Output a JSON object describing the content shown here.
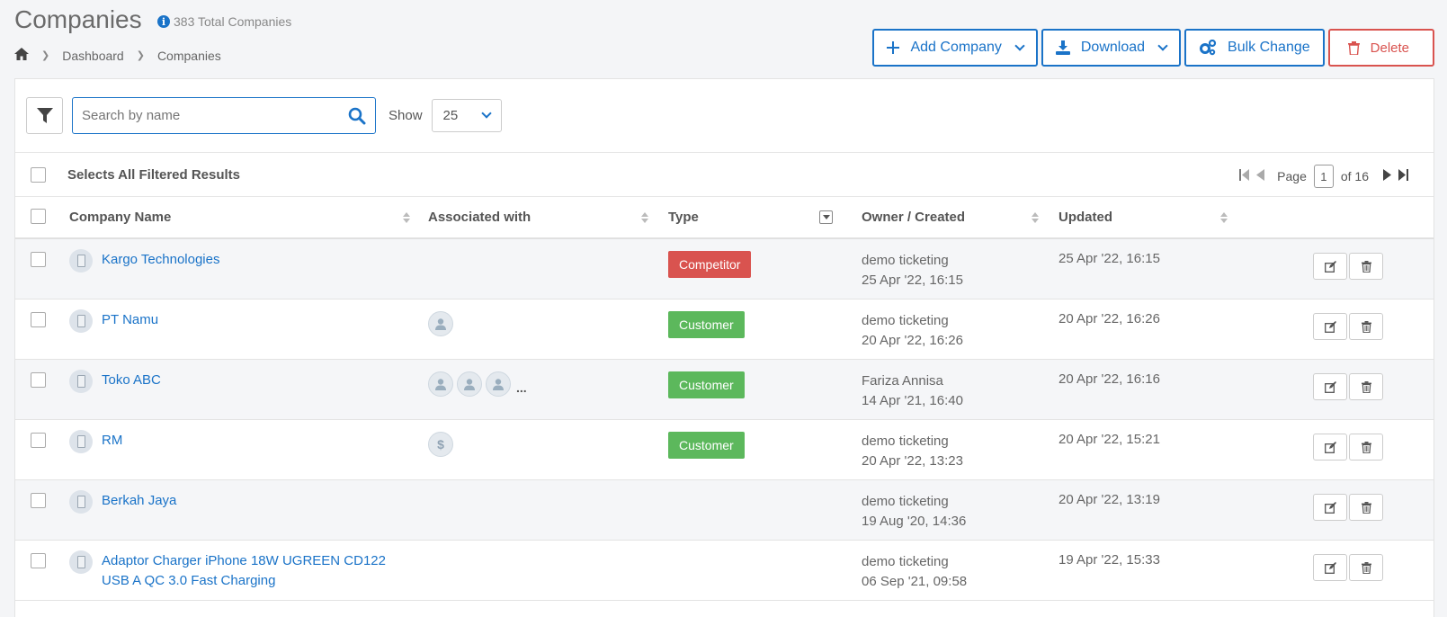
{
  "header": {
    "title": "Companies",
    "total": "383 Total Companies",
    "breadcrumb": [
      "Dashboard",
      "Companies"
    ]
  },
  "actions": {
    "add": "Add Company",
    "download": "Download",
    "bulk": "Bulk Change",
    "delete": "Delete"
  },
  "toolbar": {
    "search_placeholder": "Search by name",
    "show_label": "Show",
    "page_size": "25"
  },
  "selection": {
    "label": "Selects All Filtered Results"
  },
  "pager": {
    "page_label": "Page",
    "current": "1",
    "of_label": "of 16"
  },
  "columns": {
    "name": "Company Name",
    "associated": "Associated with",
    "type": "Type",
    "owner": "Owner / Created",
    "updated": "Updated"
  },
  "colors": {
    "accent": "#1a73c8",
    "competitor": "#d9534f",
    "customer": "#5cb85c",
    "danger": "#d9534f"
  },
  "rows": [
    {
      "name": "Kargo Technologies",
      "assoc": [],
      "more": "",
      "type": "Competitor",
      "owner": "demo ticketing",
      "created": "25 Apr '22, 16:15",
      "updated": "25 Apr '22, 16:15"
    },
    {
      "name": "PT Namu",
      "assoc": [
        "person-icon"
      ],
      "more": "",
      "type": "Customer",
      "owner": "demo ticketing",
      "created": "20 Apr '22, 16:26",
      "updated": "20 Apr '22, 16:26"
    },
    {
      "name": "Toko ABC",
      "assoc": [
        "person-icon",
        "person-icon",
        "person-icon"
      ],
      "more": "...",
      "type": "Customer",
      "owner": "Fariza Annisa",
      "created": "14 Apr '21, 16:40",
      "updated": "20 Apr '22, 16:16"
    },
    {
      "name": "RM",
      "assoc": [
        "dollar-icon"
      ],
      "more": "",
      "type": "Customer",
      "owner": "demo ticketing",
      "created": "20 Apr '22, 13:23",
      "updated": "20 Apr '22, 15:21"
    },
    {
      "name": "Berkah Jaya",
      "assoc": [],
      "more": "",
      "type": "",
      "owner": "demo ticketing",
      "created": "19 Aug '20, 14:36",
      "updated": "20 Apr '22, 13:19"
    },
    {
      "name": "Adaptor Charger iPhone 18W UGREEN CD122 USB A QC 3.0 Fast Charging",
      "assoc": [],
      "more": "",
      "type": "",
      "owner": "demo ticketing",
      "created": "06 Sep '21, 09:58",
      "updated": "19 Apr '22, 15:33"
    }
  ]
}
